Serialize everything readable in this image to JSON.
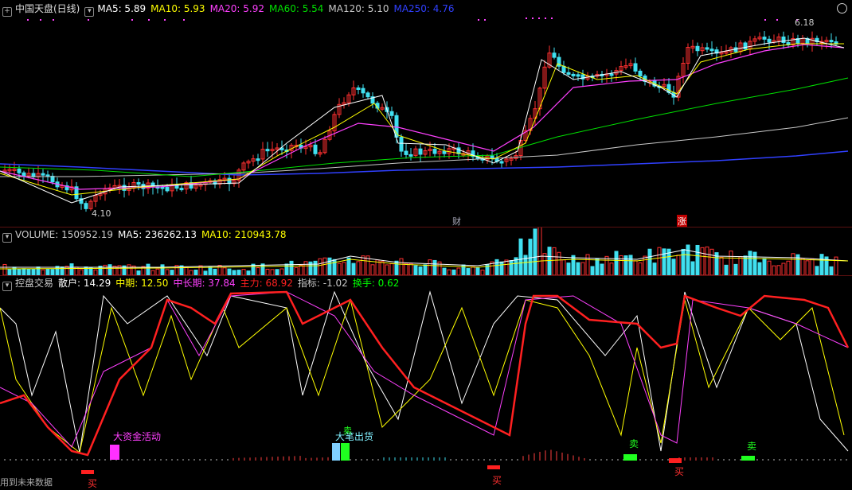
{
  "main": {
    "title": "中国天盘(日线)",
    "indicators": [
      {
        "label": "MA5: 5.89",
        "color": "#ffffff"
      },
      {
        "label": "MA10: 5.93",
        "color": "#ffff00"
      },
      {
        "label": "MA20: 5.92",
        "color": "#ff40ff"
      },
      {
        "label": "MA60: 5.54",
        "color": "#00e000"
      },
      {
        "label": "MA120: 5.10",
        "color": "#c8c8c8"
      },
      {
        "label": "MA250: 4.76",
        "color": "#3040ff"
      }
    ],
    "high_label": "6.18",
    "low_label": "4.10",
    "event_cai": "财",
    "event_zhang": "涨"
  },
  "volume": {
    "indicators": [
      {
        "label": "VOLUME: 150952.19",
        "color": "#c8c8c8"
      },
      {
        "label": "MA5: 236262.13",
        "color": "#ffffff"
      },
      {
        "label": "MA10: 210943.78",
        "color": "#ffff00"
      }
    ]
  },
  "kongpan": {
    "indicators": [
      {
        "label": "控盘交易",
        "color": "#c8c8c8"
      },
      {
        "label": "散户: 14.29",
        "color": "#ffffff"
      },
      {
        "label": "中期: 12.50",
        "color": "#ffff00"
      },
      {
        "label": "中长期: 37.84",
        "color": "#ff40ff"
      },
      {
        "label": "主力: 68.92",
        "color": "#ff2020"
      },
      {
        "label": "指标: -1.02",
        "color": "#c8c8c8"
      },
      {
        "label": "换手: 0.62",
        "color": "#00ff00"
      }
    ],
    "signals": {
      "big_fund": "大资金活动",
      "big_sell": "大笔出货",
      "buy": "买",
      "sell": "卖"
    }
  },
  "footer": "用到未来数据",
  "colors": {
    "up": "#ff3030",
    "down": "#40e0f0",
    "panel_sep": "#5a1010"
  }
}
